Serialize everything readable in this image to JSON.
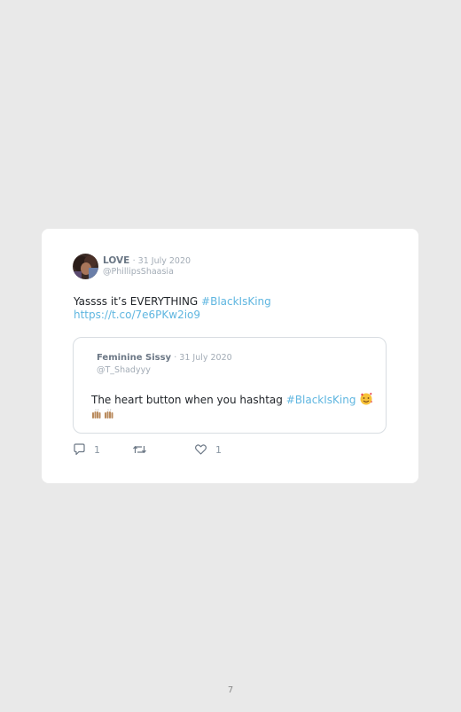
{
  "tweet": {
    "author_name": "LOVE",
    "date": "31 July 2020",
    "handle": "@PhillipsShaasia",
    "text_before": "Yassss it’s EVERYTHING ",
    "hashtag": "#BlackIsKing",
    "link": "https://t.co/7e6PKw2io9"
  },
  "quote": {
    "author_name": "Feminine Sissy",
    "date": "31 July 2020",
    "handle": "@T_Shadyyy",
    "text_before": "The heart button when you hashtag ",
    "hashtag": "#BlackIsKing",
    "emojis": [
      "smiling-face-with-hearts",
      "raising-hands",
      "raising-hands"
    ]
  },
  "actions": {
    "reply_count": "1",
    "retweet_count": "",
    "like_count": "1"
  },
  "colors": {
    "link": "#5fb6e0",
    "muted": "#a3acb6",
    "background": "#e9e9e9",
    "card": "#ffffff"
  },
  "page": {
    "number": "7"
  }
}
